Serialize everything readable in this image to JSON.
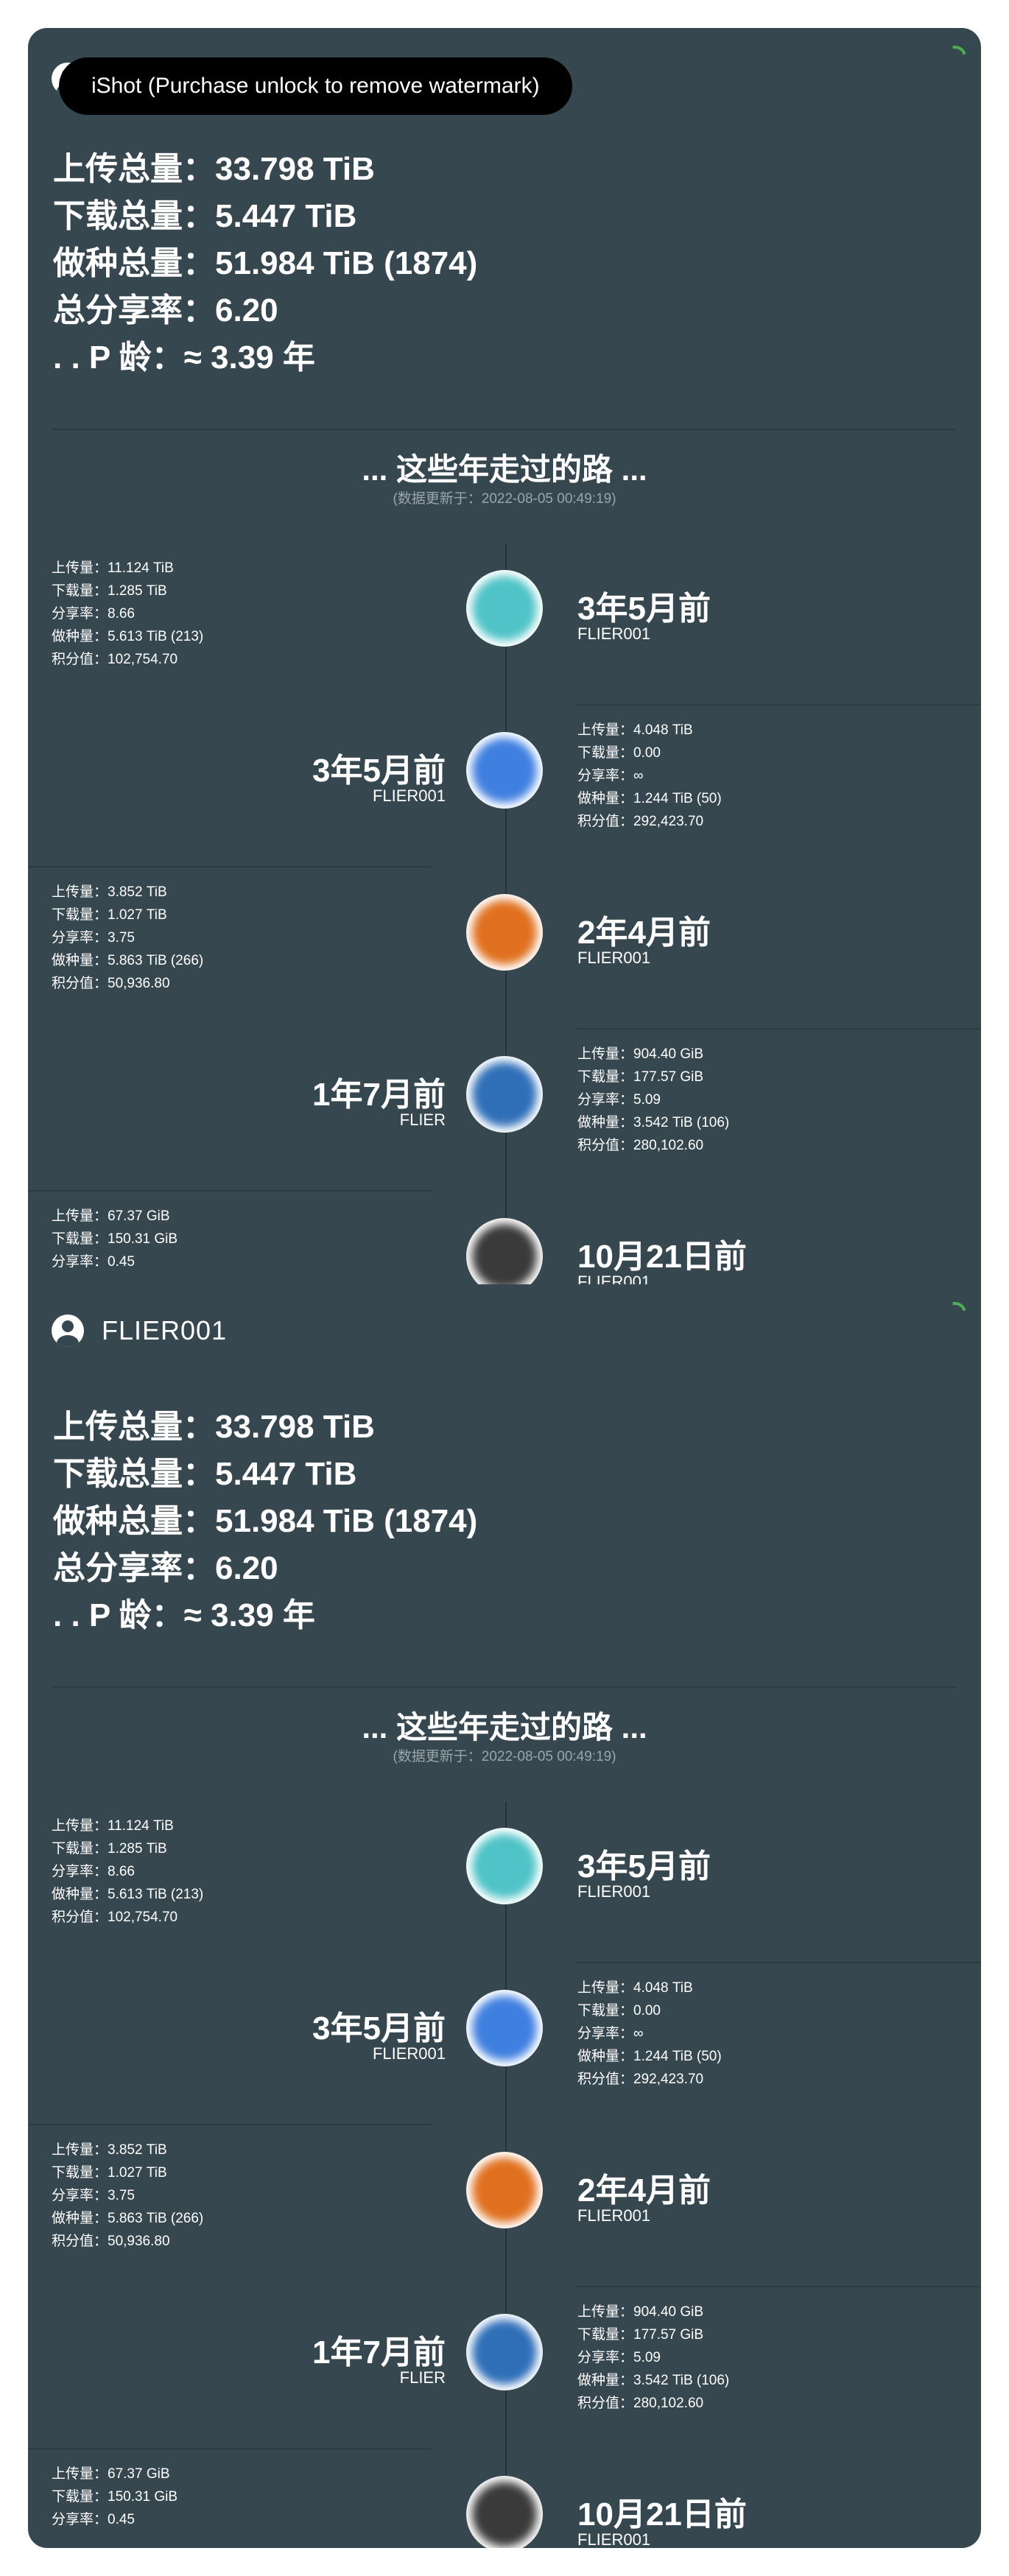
{
  "watermark": "iShot (Purchase unlock to remove watermark)",
  "profile": {
    "username": "FLIER001",
    "stats": [
      "上传总量：33.798 TiB",
      "下载总量：5.447 TiB",
      "做种总量：51.984 TiB (1874)",
      "总分享率：6.20",
      ".   .   P 龄：≈ 3.39 年"
    ]
  },
  "journey": {
    "title": "... 这些年走过的路 ...",
    "updated": "(数据更新于：2022-08-05 00:49:19)",
    "entries": [
      {
        "time": "3年5月前",
        "user": "FLIER001",
        "details": [
          "上传量：11.124 TiB",
          "下载量：1.285 TiB",
          "分享率：8.66",
          "做种量：5.613 TiB (213)",
          "积分值：102,754.70"
        ],
        "avatar_color": "#4fc3c7"
      },
      {
        "time": "3年5月前",
        "user": "FLIER001",
        "details": [
          "上传量：4.048 TiB",
          "下载量：0.00",
          "分享率：∞",
          "做种量：1.244 TiB (50)",
          "积分值：292,423.70"
        ],
        "avatar_color": "#3f7fe0"
      },
      {
        "time": "2年4月前",
        "user": "FLIER001",
        "details": [
          "上传量：3.852 TiB",
          "下载量：1.027 TiB",
          "分享率：3.75",
          "做种量：5.863 TiB (266)",
          "积分值：50,936.80"
        ],
        "avatar_color": "#e0701f"
      },
      {
        "time": "1年7月前",
        "user": "FLIER",
        "details": [
          "上传量：904.40 GiB",
          "下载量：177.57 GiB",
          "分享率：5.09",
          "做种量：3.542 TiB (106)",
          "积分值：280,102.60"
        ],
        "avatar_color": "#2f6fb8"
      },
      {
        "time": "10月21日前",
        "user": "FLIER001",
        "details": [
          "上传量：67.37 GiB",
          "下载量：150.31 GiB",
          "分享率：0.45"
        ],
        "avatar_color": "#3a3a3a"
      }
    ]
  }
}
